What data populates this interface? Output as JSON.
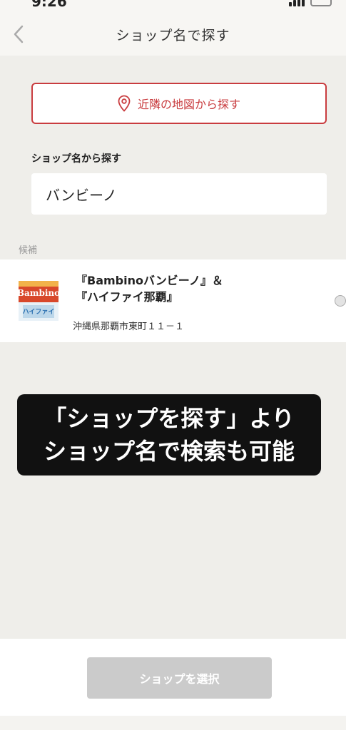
{
  "nav": {
    "title": "ショップ名で探す"
  },
  "map_search": {
    "label": "近隣の地図から探す",
    "icon": "map-pin-icon",
    "color": "#c93c3f"
  },
  "shop_name_search": {
    "label": "ショップ名から探す",
    "value": "バンビーノ"
  },
  "candidates": {
    "label": "候補",
    "items": [
      {
        "name_line1": "『Bambinoバンビーノ』＆",
        "name_line2": "『ハイファイ那覇』",
        "address": "沖縄県那覇市東町１１－１",
        "thumb_text_top": "Bambino",
        "thumb_text_bottom": "ハイファイ"
      }
    ]
  },
  "caption": {
    "line1": "「ショップを探す」より",
    "line2": "ショップ名で検索も可能"
  },
  "footer": {
    "select_label": "ショップを選択"
  }
}
